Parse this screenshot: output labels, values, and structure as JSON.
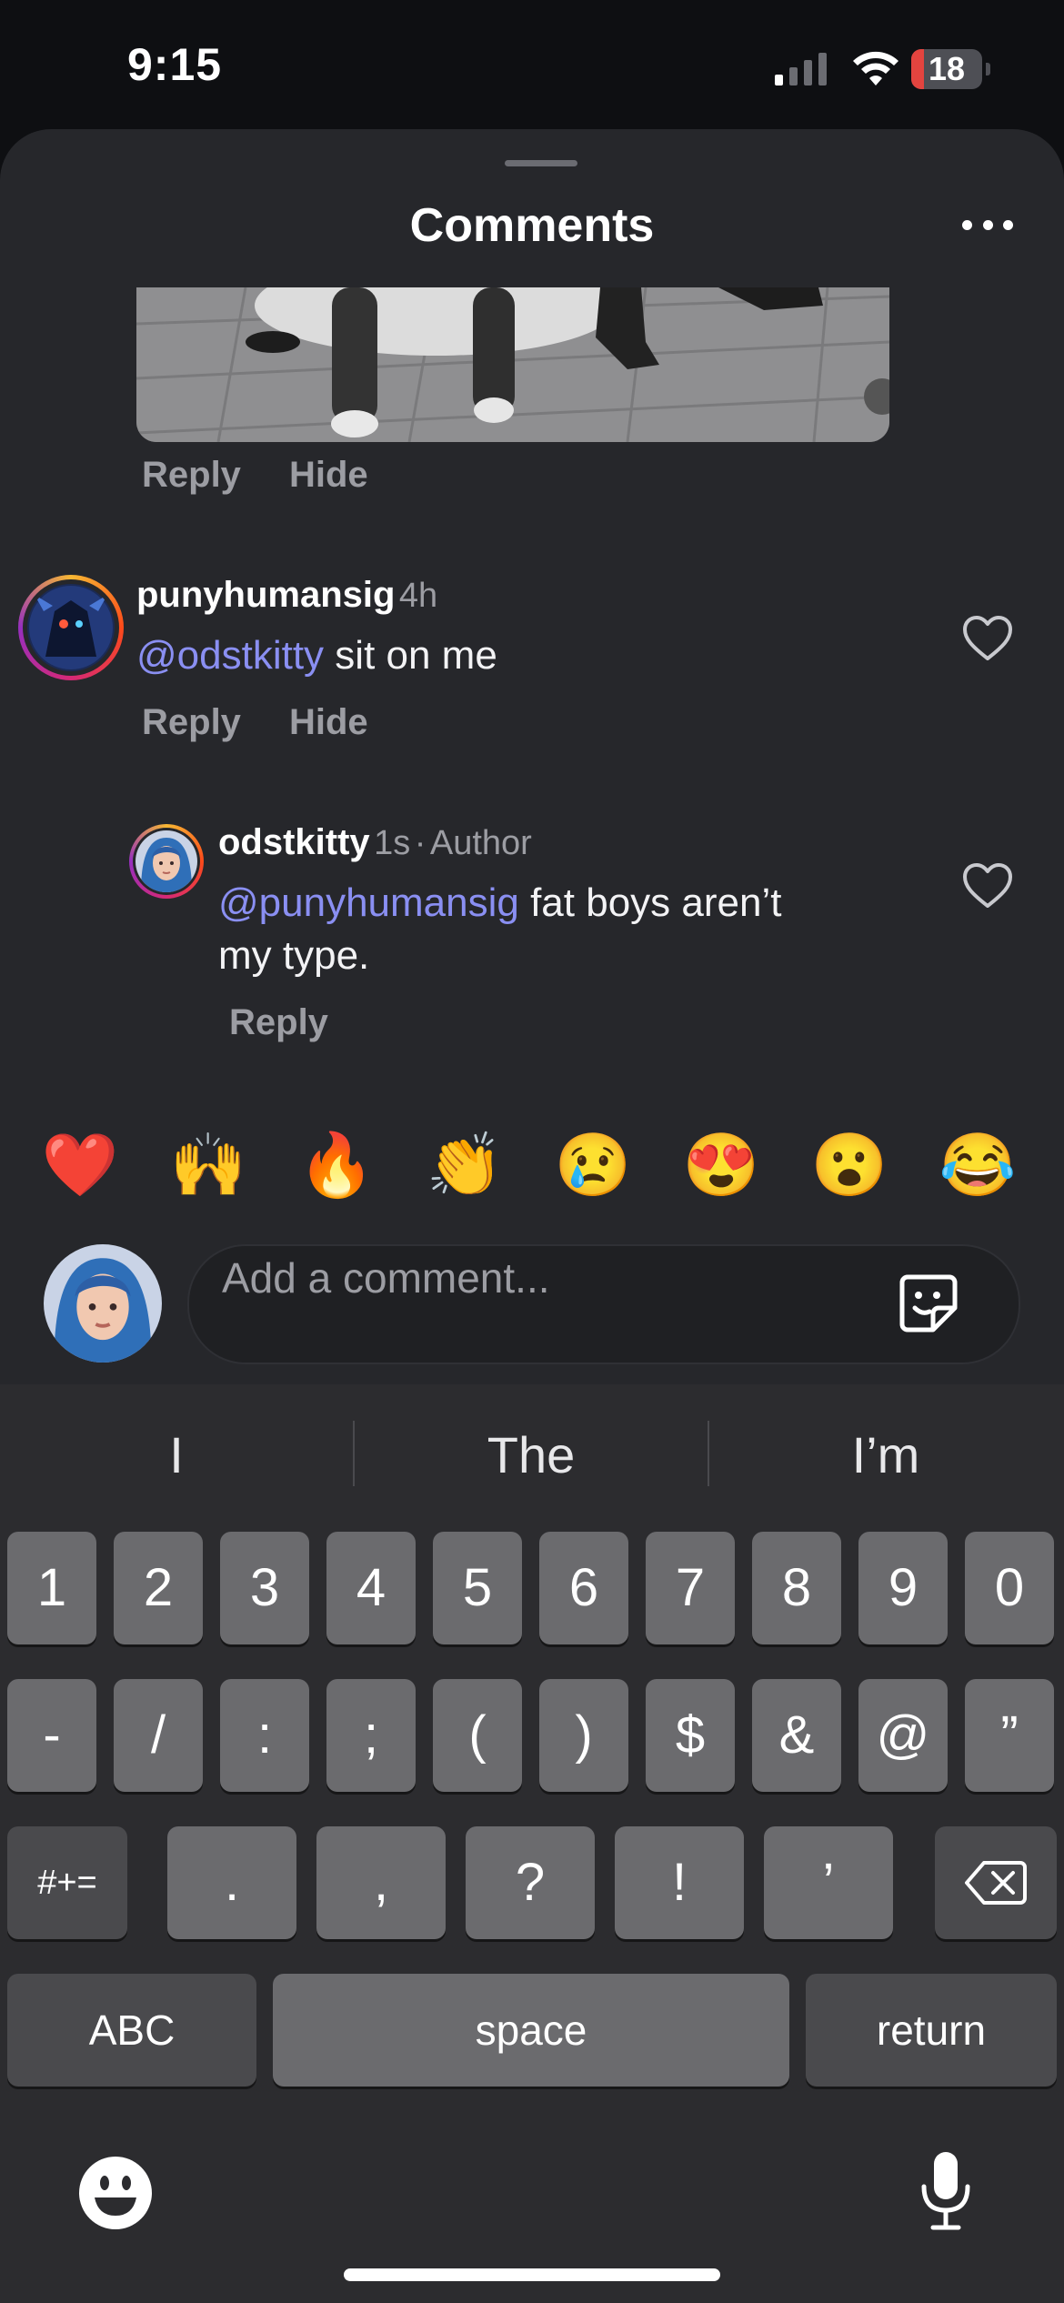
{
  "status_bar": {
    "time": "9:15",
    "battery_level": "18",
    "battery_fraction": 0.18,
    "icons": [
      "signal-icon",
      "wifi-icon",
      "battery-icon"
    ]
  },
  "sheet": {
    "title": "Comments",
    "more_icon": "more-horizontal-icon"
  },
  "top_comment_actions": {
    "reply": "Reply",
    "hide": "Hide"
  },
  "comments": [
    {
      "username": "punyhumansig",
      "time": "4h",
      "mention": "@odstkitty",
      "text": " sit on me",
      "reply": "Reply",
      "hide": "Hide"
    },
    {
      "username": "odstkitty",
      "time": "1s",
      "separator": "·",
      "badge": "Author",
      "mention": "@punyhumansig",
      "text_line1": " fat boys aren’t",
      "text_line2": "my type.",
      "reply": "Reply"
    }
  ],
  "emoji_bar": [
    "❤️",
    "🙌",
    "🔥",
    "👏",
    "😢",
    "😍",
    "😮",
    "😂"
  ],
  "composer": {
    "placeholder": "Add a comment...",
    "sticker_icon": "sticker-icon"
  },
  "keyboard": {
    "suggestions": [
      "I",
      "The",
      "I’m"
    ],
    "row1": [
      "1",
      "2",
      "3",
      "4",
      "5",
      "6",
      "7",
      "8",
      "9",
      "0"
    ],
    "row2": [
      "-",
      "/",
      ":",
      ";",
      "(",
      ")",
      "$",
      "&",
      "@",
      "”"
    ],
    "row3_left": "#+=",
    "row3": [
      ".",
      ",",
      "?",
      "!",
      "’"
    ],
    "row3_right_icon": "backspace-icon",
    "abc": "ABC",
    "space": "space",
    "return": "return",
    "emoji_icon": "emoji-icon",
    "mic_icon": "microphone-icon"
  },
  "colors": {
    "background": "#0e0f12",
    "sheet": "#26272b",
    "mention": "#8a8ff2",
    "secondary_text": "#9c9da3",
    "battery_low": "#e3443f",
    "key": "#6b6b6e",
    "key_dark": "#4a4a4d"
  }
}
